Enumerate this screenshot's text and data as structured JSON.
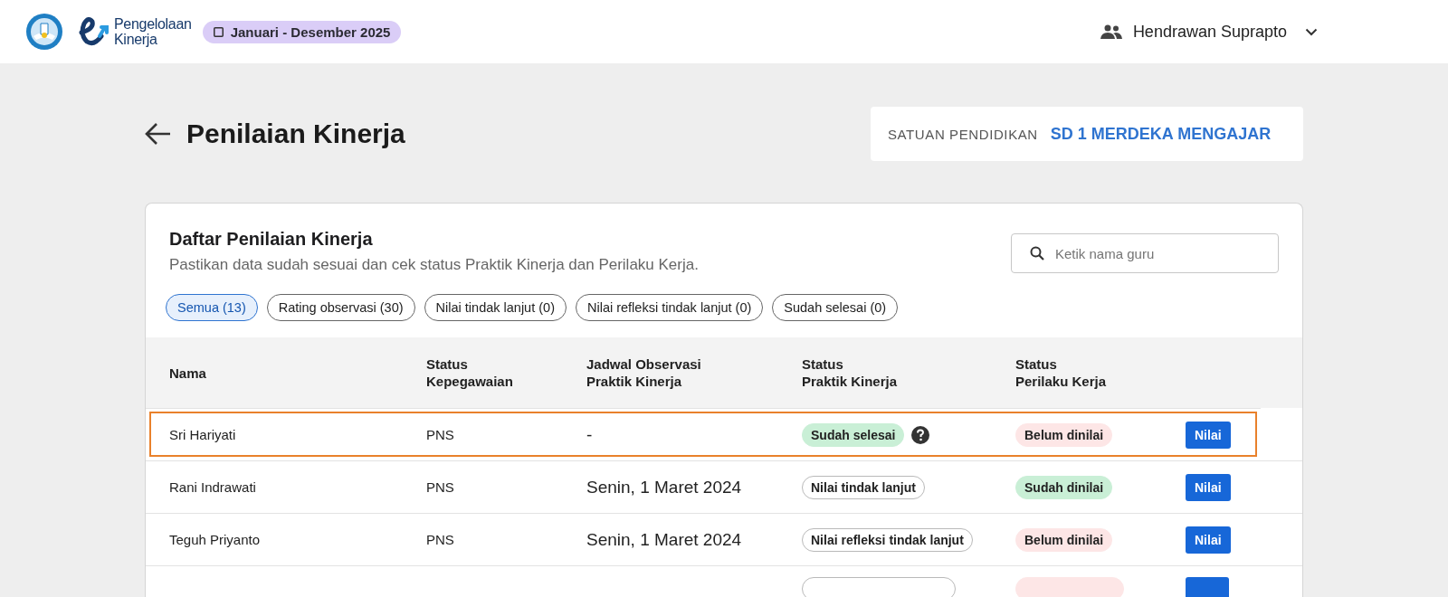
{
  "header": {
    "app_name_lines": [
      "Pengelolaan",
      "Kinerja"
    ],
    "period": "Januari - Desember 2025",
    "user": "Hendrawan Suprapto"
  },
  "page": {
    "title": "Penilaian Kinerja",
    "unit_label": "SATUAN PENDIDIKAN",
    "unit_value": "SD 1 MERDEKA MENGAJAR"
  },
  "list": {
    "title": "Daftar Penilaian Kinerja",
    "subtitle": "Pastikan data sudah sesuai dan cek status Praktik Kinerja dan Perilaku Kerja.",
    "search": {
      "placeholder": "Ketik nama guru"
    },
    "filters": [
      {
        "label": "Semua (13)",
        "selected": true
      },
      {
        "label": "Rating observasi (30)",
        "selected": false
      },
      {
        "label": "Nilai tindak lanjut (0)",
        "selected": false
      },
      {
        "label": "Nilai refleksi tindak lanjut (0)",
        "selected": false
      },
      {
        "label": "Sudah selesai (0)",
        "selected": false
      }
    ],
    "table": {
      "columns": [
        {
          "lines": [
            "Nama"
          ]
        },
        {
          "lines": [
            "Status",
            "Kepegawaian"
          ]
        },
        {
          "lines": [
            "Jadwal Observasi",
            "Praktik Kinerja"
          ]
        },
        {
          "lines": [
            "Status",
            "Praktik Kinerja"
          ]
        },
        {
          "lines": [
            "Status",
            "Perilaku Kerja"
          ]
        }
      ],
      "rows": [
        {
          "partial": false,
          "highlighted": true,
          "nama": "Sri Hariyati",
          "kepegawaian": "PNS",
          "jadwal": "-",
          "praktik": {
            "label": "Sudah selesai",
            "kind": "success",
            "help": true
          },
          "perilaku": {
            "label": "Belum dinilai",
            "kind": "pending"
          },
          "action": "Nilai"
        },
        {
          "partial": false,
          "highlighted": false,
          "nama": "Rani Indrawati",
          "kepegawaian": "PNS",
          "jadwal": "Senin, 1 Maret 2024",
          "praktik": {
            "label": "Nilai tindak lanjut",
            "kind": "outline",
            "help": false
          },
          "perilaku": {
            "label": "Sudah dinilai",
            "kind": "success"
          },
          "action": "Nilai"
        },
        {
          "partial": false,
          "highlighted": false,
          "nama": "Teguh Priyanto",
          "kepegawaian": "PNS",
          "jadwal": "Senin, 1 Maret 2024",
          "praktik": {
            "label": "Nilai refleksi tindak lanjut",
            "kind": "outline",
            "help": false
          },
          "perilaku": {
            "label": "Belum dinilai",
            "kind": "pending"
          },
          "action": "Nilai"
        },
        {
          "partial": true,
          "highlighted": false,
          "praktik": {
            "kind": "outline"
          },
          "perilaku": {
            "kind": "pending"
          }
        }
      ]
    }
  }
}
